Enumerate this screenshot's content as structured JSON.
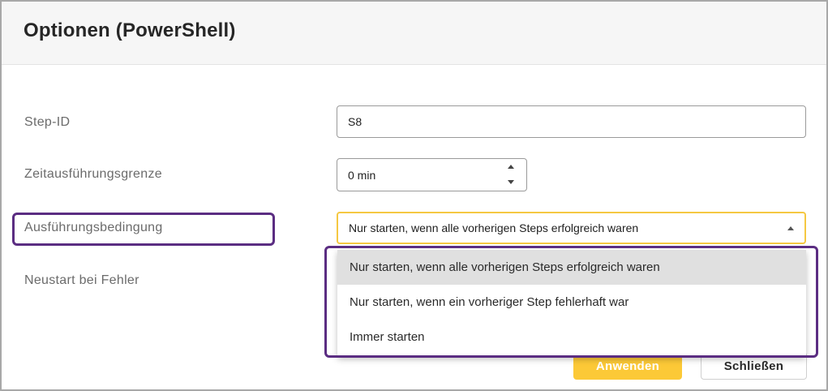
{
  "dialog": {
    "title": "Optionen (PowerShell)"
  },
  "fields": {
    "step_id": {
      "label": "Step-ID",
      "value": "S8"
    },
    "time_limit": {
      "label": "Zeitausführungsgrenze",
      "value": "0 min"
    },
    "condition": {
      "label": "Ausführungsbedingung",
      "value": "Nur starten, wenn alle vorherigen Steps erfolgreich waren",
      "options": [
        "Nur starten, wenn alle vorherigen Steps erfolgreich waren",
        "Nur starten, wenn ein vorheriger Step fehlerhaft war",
        "Immer starten"
      ]
    },
    "restart": {
      "label": "Neustart bei Fehler"
    }
  },
  "buttons": {
    "apply": "Anwenden",
    "close": "Schließen"
  },
  "colors": {
    "accent": "#fcc937",
    "highlight": "#5b2d82"
  },
  "icons": {
    "spin_up": "chevron-up-icon",
    "spin_down": "chevron-down-icon",
    "select_caret": "caret-up-icon"
  }
}
